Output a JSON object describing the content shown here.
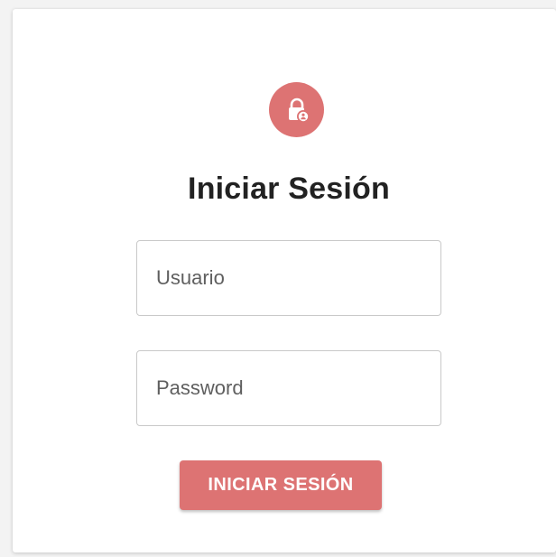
{
  "header": {
    "icon": "lock-person-icon",
    "title": "Iniciar Sesión"
  },
  "form": {
    "username": {
      "value": "",
      "placeholder": "Usuario"
    },
    "password": {
      "value": "",
      "placeholder": "Password"
    },
    "submit_label": "INICIAR SESIÓN"
  },
  "colors": {
    "accent": "#dd7373",
    "title_text": "#222222",
    "field_border": "#c9c9c9"
  }
}
